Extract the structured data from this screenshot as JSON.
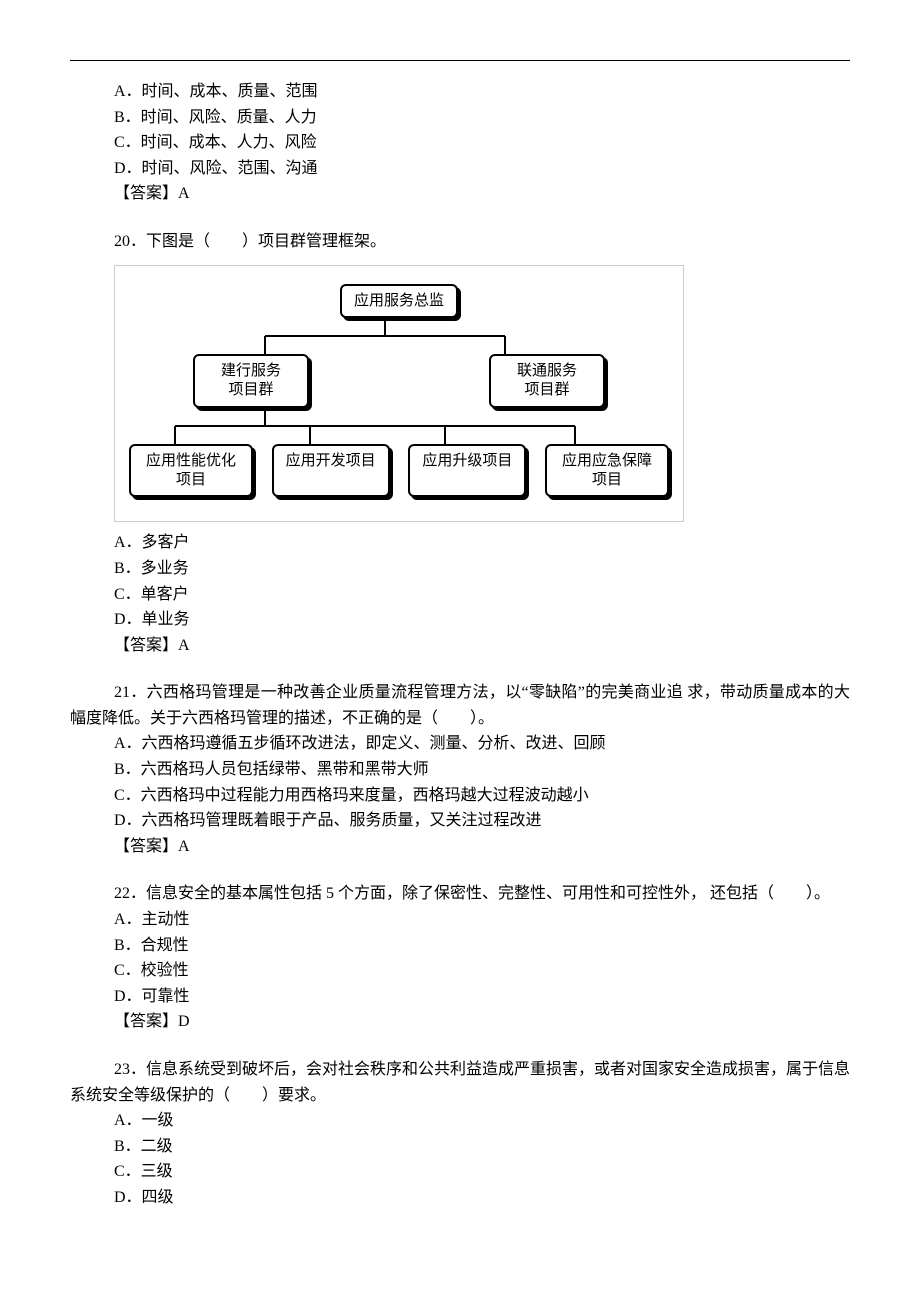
{
  "q19_tail": {
    "A": "A．时间、成本、质量、范围",
    "B": "B．时间、风险、质量、人力",
    "C": "C．时间、成本、人力、风险",
    "D": "D．时间、风险、范围、沟通",
    "answer": "【答案】A"
  },
  "q20": {
    "stem": "20．下图是（　　）项目群管理框架。",
    "diagram": {
      "top": "应用服务总监",
      "mid_left": "建行服务\n项目群",
      "mid_right": "联通服务\n项目群",
      "leaf": [
        "应用性能优化\n项目",
        "应用开发项目",
        "应用升级项目",
        "应用应急保障\n项目"
      ]
    },
    "A": "A．多客户",
    "B": "B．多业务",
    "C": "C．单客户",
    "D": "D．单业务",
    "answer": "【答案】A"
  },
  "q21": {
    "stem": "21．六西格玛管理是一种改善企业质量流程管理方法，以“零缺陷”的完美商业追 求，带动质量成本的大幅度降低。关于六西格玛管理的描述，不正确的是（　　）。",
    "A": "A．六西格玛遵循五步循环改进法，即定义、测量、分析、改进、回顾",
    "B": "B．六西格玛人员包括绿带、黑带和黑带大师",
    "C": "C．六西格玛中过程能力用西格玛来度量，西格玛越大过程波动越小",
    "D": "D．六西格玛管理既着眼于产品、服务质量，又关注过程改进",
    "answer": "【答案】A"
  },
  "q22": {
    "stem": "22．信息安全的基本属性包括 5 个方面，除了保密性、完整性、可用性和可控性外， 还包括（　　）。",
    "A": "A．主动性",
    "B": "B．合规性",
    "C": "C．校验性",
    "D": "D．可靠性",
    "answer": "【答案】D"
  },
  "q23": {
    "stem": "23．信息系统受到破坏后，会对社会秩序和公共利益造成严重损害，或者对国家安全造成损害，属于信息系统安全等级保护的（　　）要求。",
    "A": "A．一级",
    "B": "B．二级",
    "C": "C．三级",
    "D": "D．四级"
  }
}
